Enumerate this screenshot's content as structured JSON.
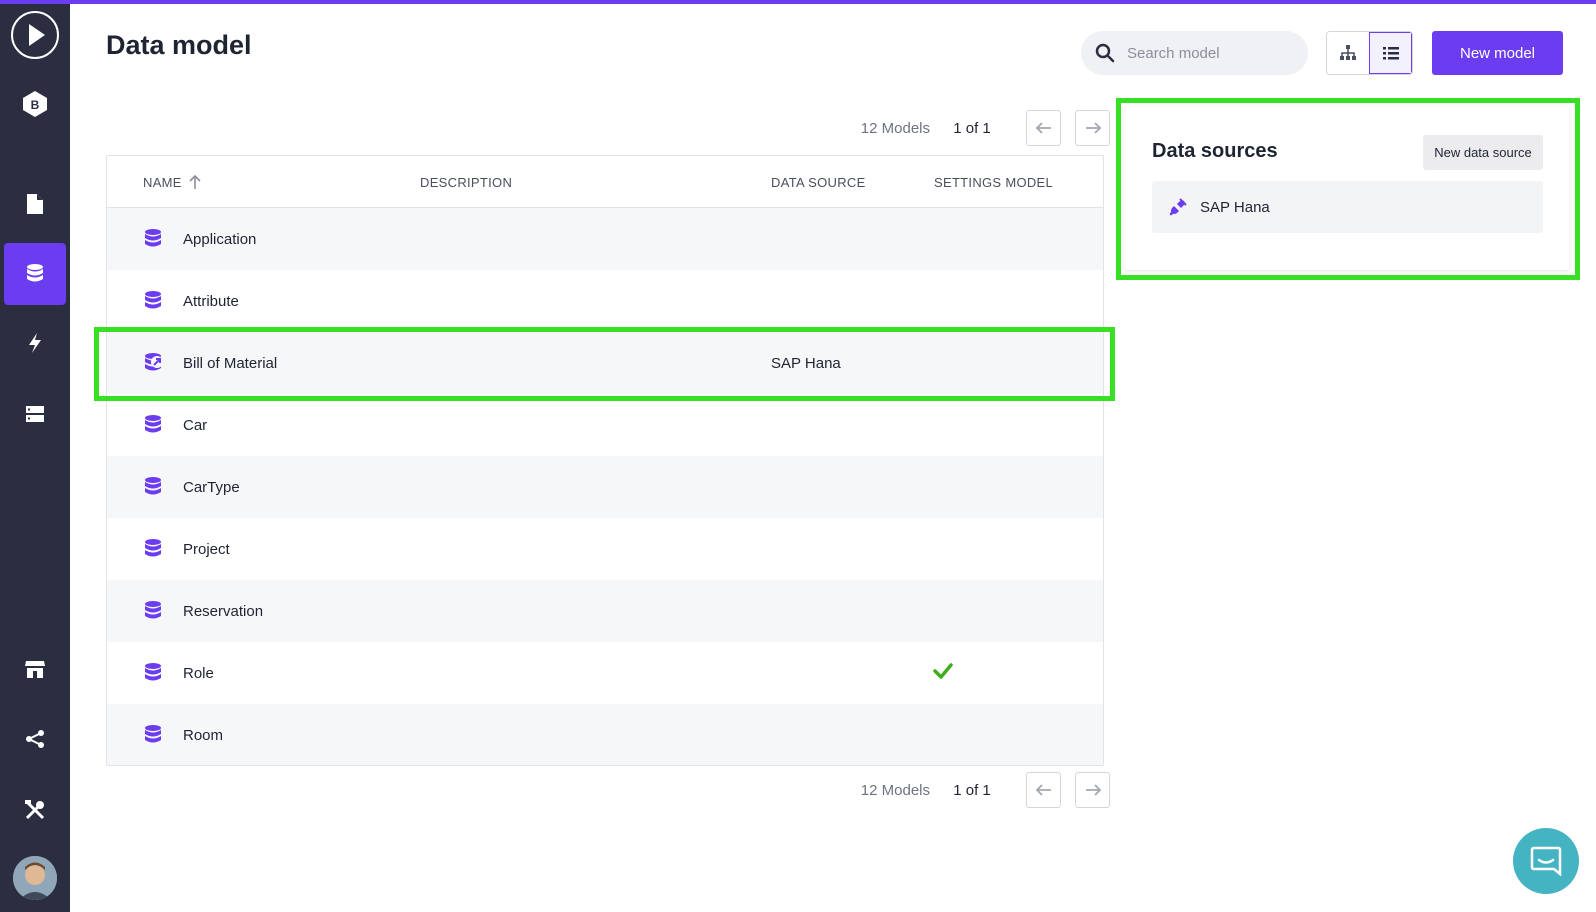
{
  "sidebar": {
    "items": [
      {
        "name": "play",
        "icon": "play-icon"
      },
      {
        "name": "budibase",
        "icon": "budibase-logo-icon",
        "label": "B"
      },
      {
        "name": "pages",
        "icon": "page-icon"
      },
      {
        "name": "data-model",
        "icon": "database-icon",
        "active": true
      },
      {
        "name": "actions",
        "icon": "lightning-icon"
      },
      {
        "name": "servers",
        "icon": "server-icon"
      },
      {
        "name": "store",
        "icon": "store-icon"
      },
      {
        "name": "share",
        "icon": "share-icon"
      },
      {
        "name": "tools",
        "icon": "tools-icon"
      }
    ],
    "accent": "#6c3cf0"
  },
  "header": {
    "title": "Data model",
    "search_placeholder": "Search model",
    "new_model_label": "New model"
  },
  "pagination": {
    "count": "12 Models",
    "pages": "1 of 1"
  },
  "table": {
    "columns": [
      "NAME",
      "DESCRIPTION",
      "DATA SOURCE",
      "SETTINGS MODEL"
    ],
    "rows": [
      {
        "name": "Application",
        "description": "",
        "data_source": "",
        "settings_model": false,
        "icon": "database-icon"
      },
      {
        "name": "Attribute",
        "description": "",
        "data_source": "",
        "settings_model": false,
        "icon": "database-icon"
      },
      {
        "name": "Bill of Material",
        "description": "",
        "data_source": "SAP Hana",
        "settings_model": false,
        "icon": "external-source-icon"
      },
      {
        "name": "Car",
        "description": "",
        "data_source": "",
        "settings_model": false,
        "icon": "database-icon"
      },
      {
        "name": "CarType",
        "description": "",
        "data_source": "",
        "settings_model": false,
        "icon": "database-icon"
      },
      {
        "name": "Project",
        "description": "",
        "data_source": "",
        "settings_model": false,
        "icon": "database-icon"
      },
      {
        "name": "Reservation",
        "description": "",
        "data_source": "",
        "settings_model": false,
        "icon": "database-icon"
      },
      {
        "name": "Role",
        "description": "",
        "data_source": "",
        "settings_model": true,
        "icon": "database-icon"
      },
      {
        "name": "Room",
        "description": "",
        "data_source": "",
        "settings_model": false,
        "icon": "database-icon"
      }
    ]
  },
  "data_sources": {
    "title": "Data sources",
    "new_label": "New data source",
    "items": [
      {
        "name": "SAP Hana",
        "icon": "plug-icon"
      }
    ]
  },
  "colors": {
    "accent": "#6c3cf0",
    "highlight": "#37e024",
    "check": "#3fae1c",
    "chat": "#44b3c2"
  }
}
